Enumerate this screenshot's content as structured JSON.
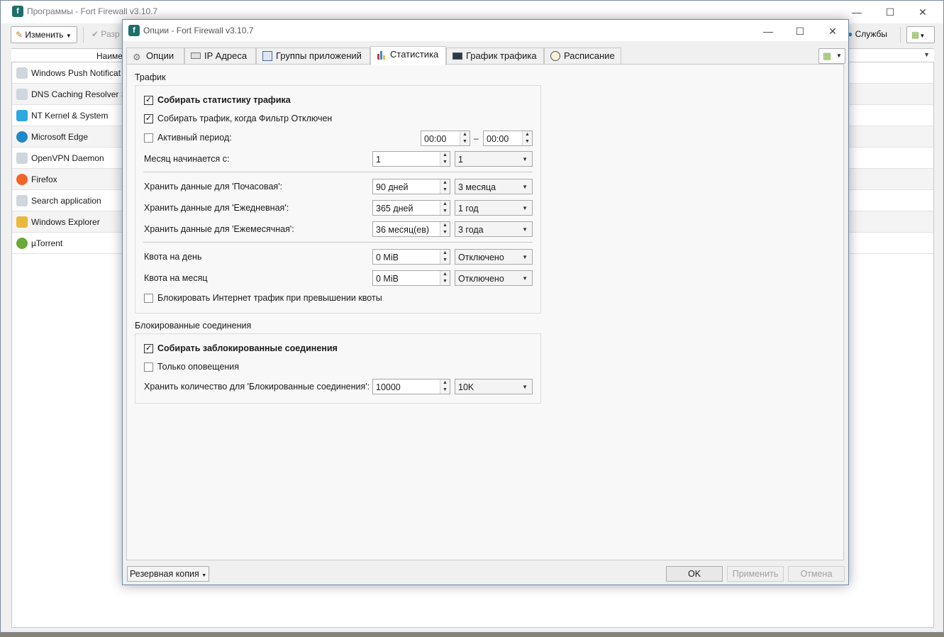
{
  "main_window": {
    "title": "Программы - Fort Firewall v3.10.7",
    "toolbar": {
      "edit_label": "Изменить",
      "allow_label": "Разр",
      "services_label": "Службы"
    },
    "list_header": {
      "name_col": "Наиме"
    },
    "programs": [
      {
        "name": "Windows Push Notificat",
        "icon_color": "#cfd6de"
      },
      {
        "name": "DNS Caching Resolver S",
        "icon_color": "#cfd6de"
      },
      {
        "name": "NT Kernel & System",
        "icon_color": "#2ea8e0"
      },
      {
        "name": "Microsoft Edge",
        "icon_color": "#1e88c8"
      },
      {
        "name": "OpenVPN Daemon",
        "icon_color": "#cfd6de"
      },
      {
        "name": "Firefox",
        "icon_color": "#f0642a"
      },
      {
        "name": "Search application",
        "icon_color": "#cfd6de"
      },
      {
        "name": "Windows Explorer",
        "icon_color": "#e9b93b"
      },
      {
        "name": "µTorrent",
        "icon_color": "#6aa83a"
      }
    ]
  },
  "dialog": {
    "title": "Опции - Fort Firewall v3.10.7",
    "tabs": [
      {
        "label": "Опции",
        "icon": "gear-icon"
      },
      {
        "label": "IP Адреса",
        "icon": "ip-addresses-icon"
      },
      {
        "label": "Группы приложений",
        "icon": "app-groups-icon"
      },
      {
        "label": "Статистика",
        "icon": "bar-chart-icon",
        "active": true
      },
      {
        "label": "График трафика",
        "icon": "traffic-graph-icon"
      },
      {
        "label": "Расписание",
        "icon": "clock-icon"
      }
    ],
    "traffic": {
      "group_title": "Трафик",
      "collect_stats": {
        "label": "Собирать статистику трафика",
        "checked": true
      },
      "collect_when_filter_off": {
        "label": "Собирать трафик, когда Фильтр Отключен",
        "checked": true
      },
      "active_period": {
        "label": "Активный период:",
        "checked": false,
        "from": "00:00",
        "dash": "–",
        "to": "00:00"
      },
      "month_start": {
        "label": "Месяц начинается с:",
        "value": "1",
        "combo": "1"
      },
      "keep_hourly": {
        "label": "Хранить данные для 'Почасовая':",
        "value": "90 дней",
        "combo": "3 месяца"
      },
      "keep_daily": {
        "label": "Хранить данные для 'Ежедневная':",
        "value": "365 дней",
        "combo": "1 год"
      },
      "keep_monthly": {
        "label": "Хранить данные для 'Ежемесячная':",
        "value": "36 месяц(ев)",
        "combo": "3 года"
      },
      "quota_day": {
        "label": "Квота на день",
        "value": "0 MiB",
        "combo": "Отключено"
      },
      "quota_month": {
        "label": "Квота на месяц",
        "value": "0 MiB",
        "combo": "Отключено"
      },
      "block_on_quota": {
        "label": "Блокировать Интернет трафик при превышении квоты",
        "checked": false
      }
    },
    "blocked": {
      "group_title": "Блокированные соединения",
      "collect_blocked": {
        "label": "Собирать заблокированные соединения",
        "checked": true
      },
      "alerts_only": {
        "label": "Только оповещения",
        "checked": false
      },
      "keep_count": {
        "label": "Хранить количество для 'Блокированные соединения':",
        "value": "10000",
        "combo": "10K"
      }
    },
    "footer": {
      "backup_label": "Резервная копия",
      "ok_label": "OK",
      "apply_label": "Применить",
      "cancel_label": "Отмена"
    }
  },
  "colors": {
    "accent": "#1e6f6a",
    "dialog_border": "#6d8bad"
  }
}
